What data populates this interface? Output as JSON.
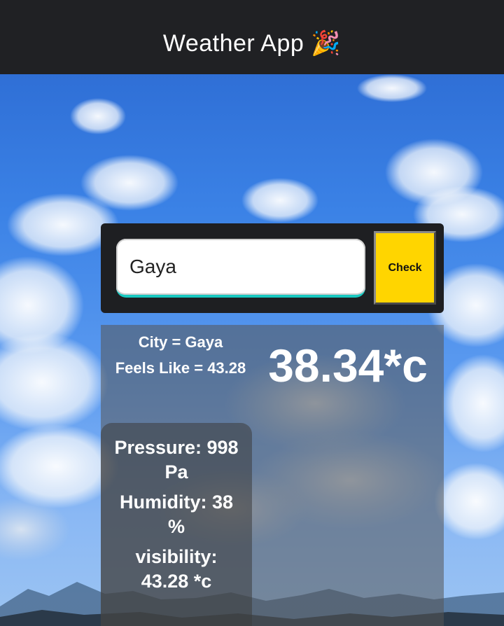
{
  "header": {
    "title": "Weather App",
    "title_icon": "party-popper-icon",
    "background": "#202124"
  },
  "search": {
    "input_value": "Gaya",
    "button_label": "Check",
    "button_color": "#ffd500",
    "input_underline_color": "#19c8c0"
  },
  "weather": {
    "city_text": "City = Gaya",
    "feels_like_text": "Feels Like = 43.28",
    "temperature_text": "38.34*c",
    "pressure_text": "Pressure: 998 Pa",
    "humidity_text": "Humidity: 38 %",
    "visibility_text": "visibility: 43.28 *c"
  },
  "background": {
    "description_icon": "sky-clouds-background",
    "sky_color": "#3b82e6"
  }
}
